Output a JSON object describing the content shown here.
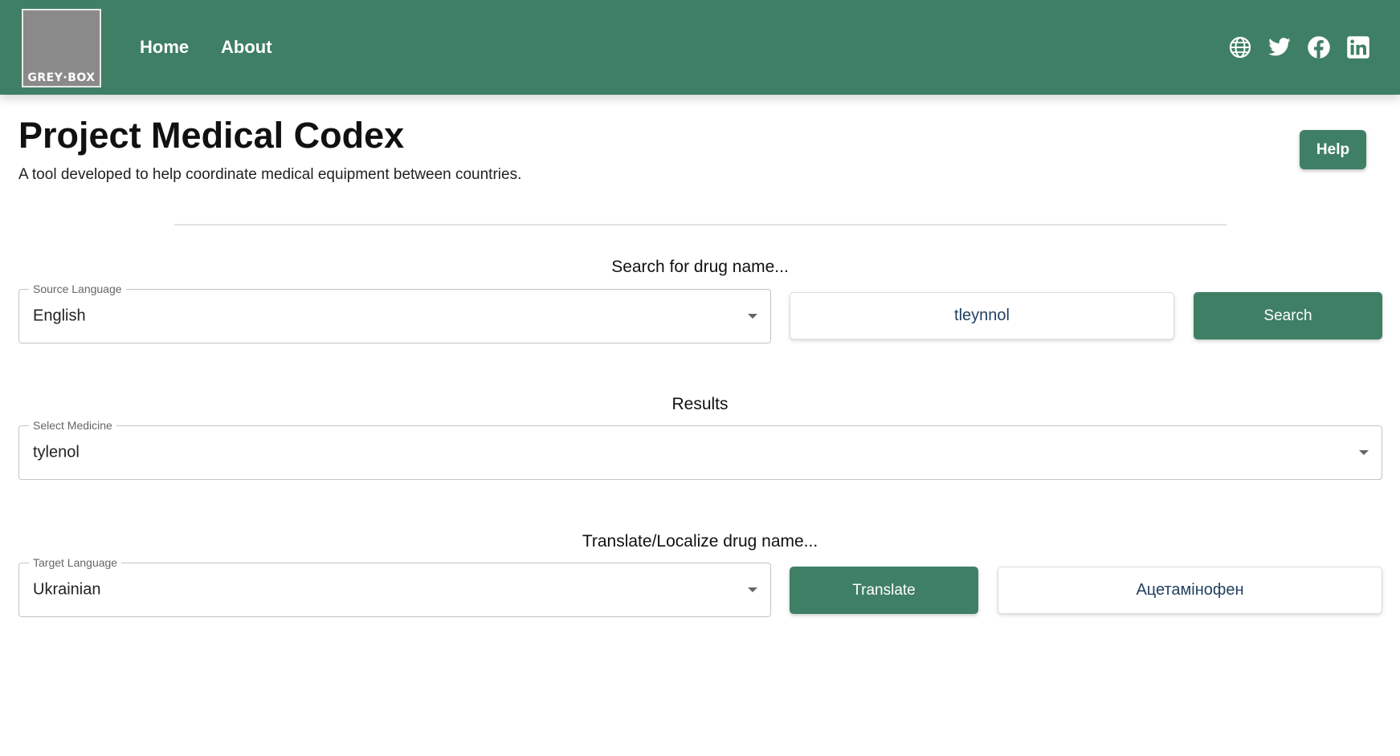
{
  "header": {
    "logo_text": "GREY·BOX",
    "nav": {
      "home": "Home",
      "about": "About"
    },
    "social_icons": [
      "globe-icon",
      "twitter-icon",
      "facebook-icon",
      "linkedin-icon"
    ],
    "background_color": "#3f7f66"
  },
  "page": {
    "title": "Project Medical Codex",
    "subtitle": "A tool developed to help coordinate medical equipment between countries.",
    "help_label": "Help"
  },
  "search": {
    "heading": "Search for drug name...",
    "source_language_label": "Source Language",
    "source_language_value": "English",
    "query_value": "tleynnol",
    "button_label": "Search"
  },
  "results": {
    "heading": "Results",
    "select_label": "Select Medicine",
    "select_value": "tylenol"
  },
  "translate": {
    "heading": "Translate/Localize drug name...",
    "target_language_label": "Target Language",
    "target_language_value": "Ukrainian",
    "button_label": "Translate",
    "output_value": "Ацетамінофен"
  },
  "colors": {
    "accent": "#3f7f66",
    "input_text": "#1f3f5f"
  }
}
